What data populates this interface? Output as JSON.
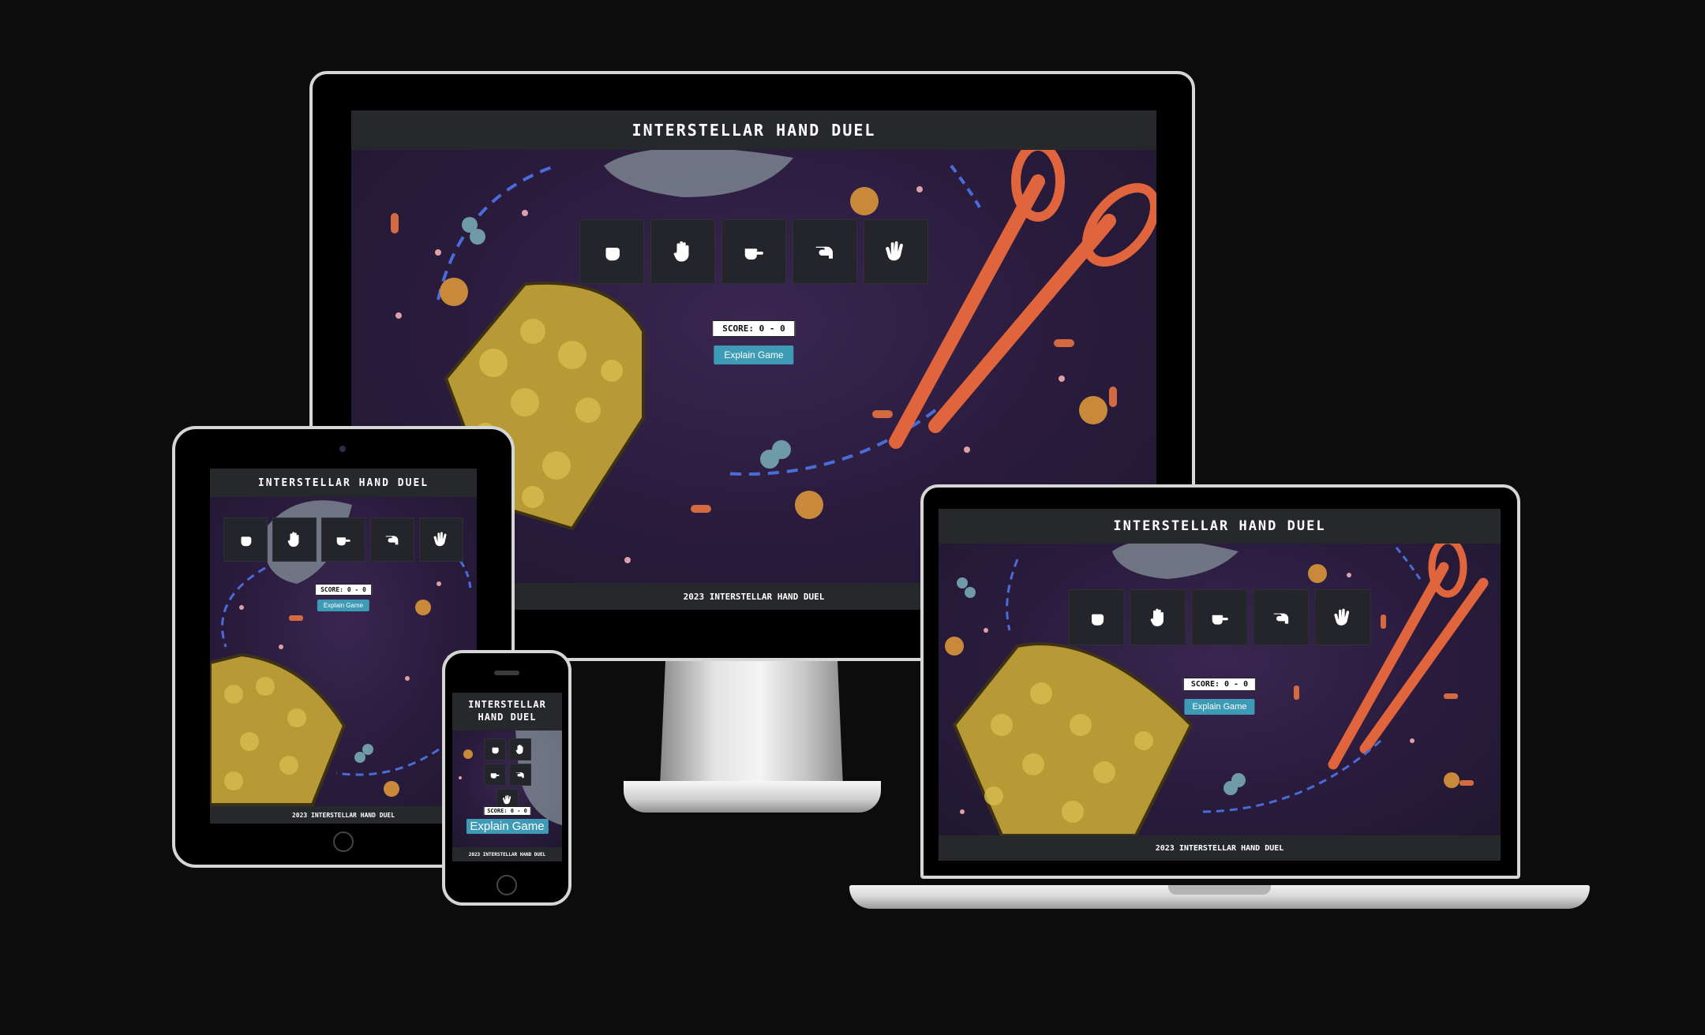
{
  "app": {
    "title": "INTERSTELLAR HAND DUEL",
    "score_label": "SCORE: 0 - 0",
    "explain_label": "Explain Game",
    "footer": "2023 INTERSTELLAR HAND DUEL"
  },
  "choices": [
    {
      "icon": "hand-rock-icon"
    },
    {
      "icon": "hand-paper-icon"
    },
    {
      "icon": "hand-scissors-icon"
    },
    {
      "icon": "hand-lizard-icon"
    },
    {
      "icon": "hand-spock-icon"
    }
  ],
  "colors": {
    "page_bg": "#0c0c0d",
    "header_bg": "#26282c",
    "main_bg": "#2a1b3d",
    "button_accent": "#3e9bb5",
    "choice_bg": "#24252a",
    "scissors": "#e0653c",
    "paper": "#b79a36",
    "arrow": "#4a6cd8"
  }
}
